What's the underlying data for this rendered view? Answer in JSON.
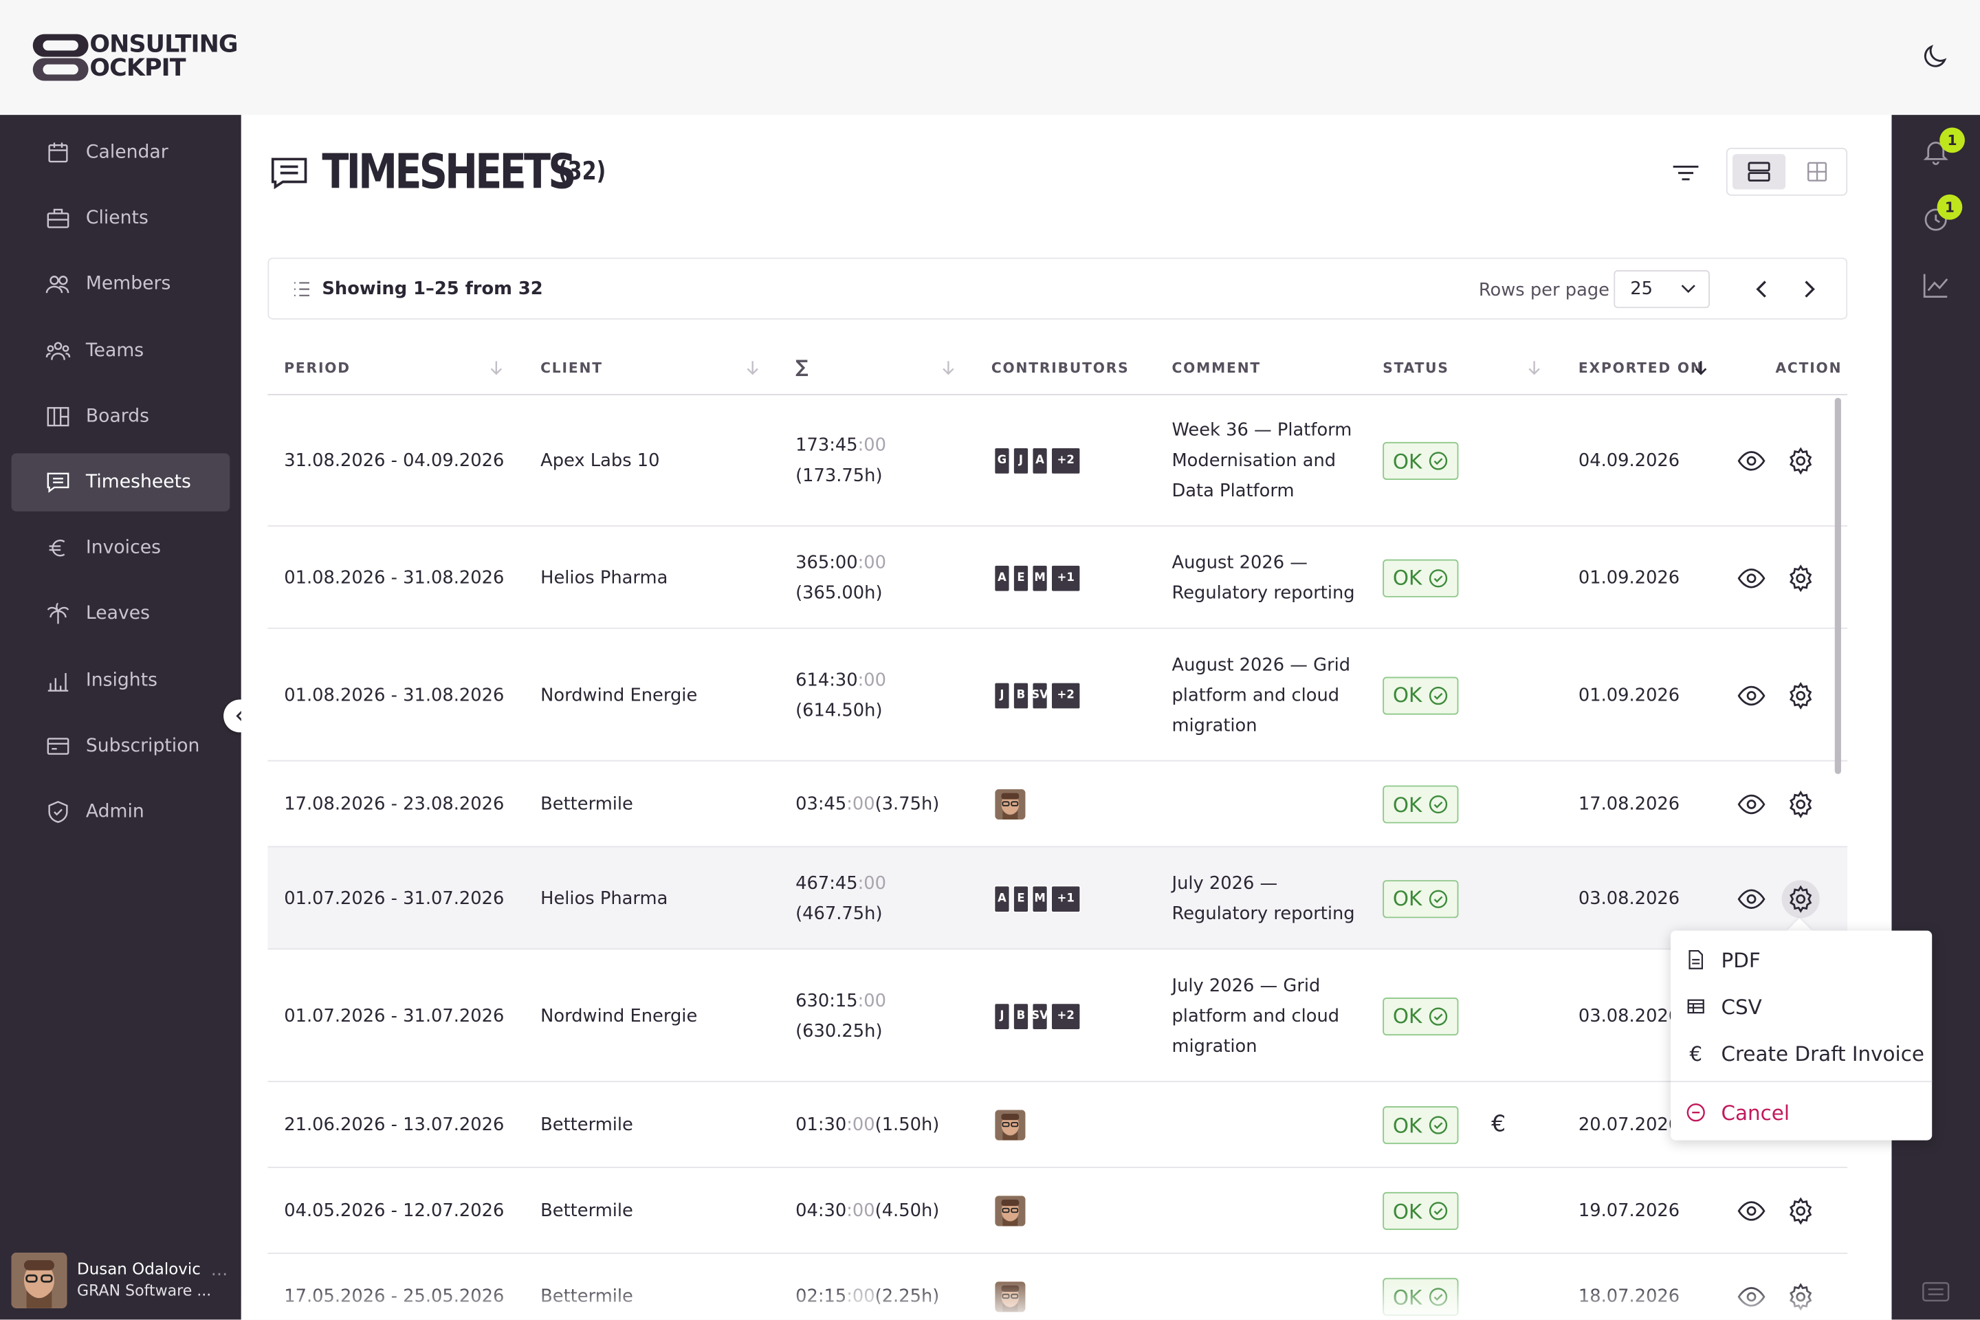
{
  "brand": {
    "line1": "ONSULTING",
    "line2": "OCKPIT"
  },
  "sidebar": {
    "items": [
      {
        "label": "Calendar",
        "icon": "calendar-icon"
      },
      {
        "label": "Clients",
        "icon": "briefcase-icon"
      },
      {
        "label": "Members",
        "icon": "members-icon"
      },
      {
        "label": "Teams",
        "icon": "teams-icon"
      },
      {
        "label": "Boards",
        "icon": "boards-icon"
      },
      {
        "label": "Timesheets",
        "icon": "timesheets-icon",
        "active": true
      },
      {
        "label": "Invoices",
        "icon": "euro-icon"
      },
      {
        "label": "Leaves",
        "icon": "palm-icon"
      },
      {
        "label": "Insights",
        "icon": "bar-chart-icon"
      },
      {
        "label": "Subscription",
        "icon": "card-icon"
      },
      {
        "label": "Admin",
        "icon": "shield-icon"
      }
    ],
    "user": {
      "name": "Dusan Odalovic",
      "org": "GRAN Software ..."
    }
  },
  "rail": {
    "notifications_badge": "1",
    "timer_badge": "1"
  },
  "page": {
    "title": "TIMESHEETS",
    "count": "(32)",
    "showing": "Showing 1–25 from 32",
    "rows_per_page_label": "Rows per page",
    "rows_per_page_value": "25"
  },
  "table": {
    "headers": {
      "period": "PERIOD",
      "client": "CLIENT",
      "sum": "∑",
      "contributors": "CONTRIBUTORS",
      "comment": "COMMENT",
      "status": "STATUS",
      "exported": "EXPORTED ON",
      "action": "ACTION"
    },
    "rows": [
      {
        "period": "31.08.2026 - 04.09.2026",
        "client": "Apex Labs 10",
        "hm": "173:45",
        "sec": ":00",
        "hours": "(173.75h)",
        "contributors": [
          "G",
          "J",
          "A"
        ],
        "more": "+2",
        "comment": [
          "Week 36 — Platform",
          "Modernisation and",
          "Data Platform"
        ],
        "status": "OK",
        "exported": "04.09.2026"
      },
      {
        "period": "01.08.2026 - 31.08.2026",
        "client": "Helios Pharma",
        "hm": "365:00",
        "sec": ":00",
        "hours": "(365.00h)",
        "contributors": [
          "A",
          "E",
          "M"
        ],
        "more": "+1",
        "comment": [
          "August 2026 —",
          "Regulatory reporting"
        ],
        "status": "OK",
        "exported": "01.09.2026"
      },
      {
        "period": "01.08.2026 - 31.08.2026",
        "client": "Nordwind Energie",
        "hm": "614:30",
        "sec": ":00",
        "hours": "(614.50h)",
        "contributors": [
          "J",
          "B",
          "SV"
        ],
        "more": "+2",
        "comment": [
          "August 2026 — Grid",
          "platform and cloud",
          "migration"
        ],
        "status": "OK",
        "exported": "01.09.2026"
      },
      {
        "period": "17.08.2026 - 23.08.2026",
        "client": "Bettermile",
        "hm": "03:45",
        "sec": ":00",
        "hours": "(3.75h)",
        "comment": [],
        "status": "OK",
        "exported": "17.08.2026"
      },
      {
        "period": "01.07.2026 - 31.07.2026",
        "client": "Helios Pharma",
        "hm": "467:45",
        "sec": ":00",
        "hours": "(467.75h)",
        "contributors": [
          "A",
          "E",
          "M"
        ],
        "more": "+1",
        "comment": [
          "July 2026 —",
          "Regulatory reporting"
        ],
        "status": "OK",
        "exported": "03.08.2026"
      },
      {
        "period": "01.07.2026 - 31.07.2026",
        "client": "Nordwind Energie",
        "hm": "630:15",
        "sec": ":00",
        "hours": "(630.25h)",
        "contributors": [
          "J",
          "B",
          "SV"
        ],
        "more": "+2",
        "comment": [
          "July 2026 — Grid",
          "platform and cloud",
          "migration"
        ],
        "status": "OK",
        "exported": "03.08.2026"
      },
      {
        "period": "21.06.2026 - 13.07.2026",
        "client": "Bettermile",
        "hm": "01:30",
        "sec": ":00",
        "hours": "(1.50h)",
        "comment": [],
        "status": "OK",
        "exported": "20.07.2026"
      },
      {
        "period": "04.05.2026 - 12.07.2026",
        "client": "Bettermile",
        "hm": "04:30",
        "sec": ":00",
        "hours": "(4.50h)",
        "comment": [],
        "status": "OK",
        "exported": "19.07.2026"
      },
      {
        "period": "17.05.2026 - 25.05.2026",
        "client": "Bettermile",
        "hm": "02:15",
        "sec": ":00",
        "hours": "(2.25h)",
        "comment": [],
        "status": "OK",
        "exported": "18.07.2026"
      }
    ]
  },
  "action_menu": {
    "items": [
      {
        "label": "PDF",
        "icon": "file-icon"
      },
      {
        "label": "CSV",
        "icon": "table-icon"
      },
      {
        "label": "Create Draft Invoice",
        "icon": "euro-icon"
      }
    ],
    "cancel": "Cancel"
  },
  "colors": {
    "sidebar": "#2f2a35",
    "ok_border": "#8fc88a",
    "ok_text": "#3d8a3a",
    "badge": "#bfe61c",
    "cancel": "#c2185b"
  }
}
